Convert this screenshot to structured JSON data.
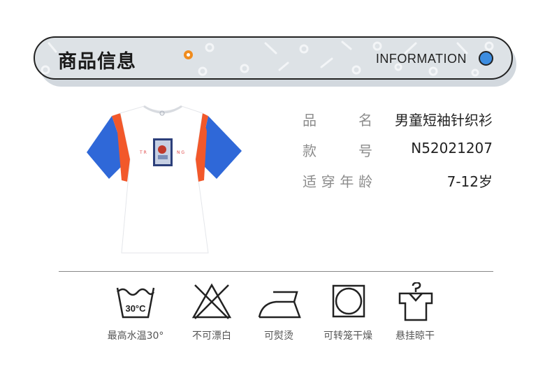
{
  "header": {
    "title": "商品信息",
    "subtitle_en": "INFORMATION",
    "accent_color": "#3d8de0",
    "dot_color": "#f08c1e"
  },
  "product_image": {
    "icon": "tshirt-product-image",
    "colors": {
      "body": "#ffffff",
      "sleeve": "#2f68d8",
      "stripe": "#f2582a"
    }
  },
  "info": [
    {
      "label": "品　　名",
      "value": "男童短袖针织衫"
    },
    {
      "label": "款　　号",
      "value": "N52021207"
    },
    {
      "label": "适穿年龄",
      "value": "7-12岁"
    }
  ],
  "care": [
    {
      "icon": "wash-30-icon",
      "label": "最高水温30°",
      "tub_text": "30°C"
    },
    {
      "icon": "no-bleach-icon",
      "label": "不可漂白"
    },
    {
      "icon": "iron-icon",
      "label": "可熨烫"
    },
    {
      "icon": "tumble-dry-icon",
      "label": "可转笼干燥"
    },
    {
      "icon": "hang-dry-icon",
      "label": "悬挂晾干"
    }
  ]
}
